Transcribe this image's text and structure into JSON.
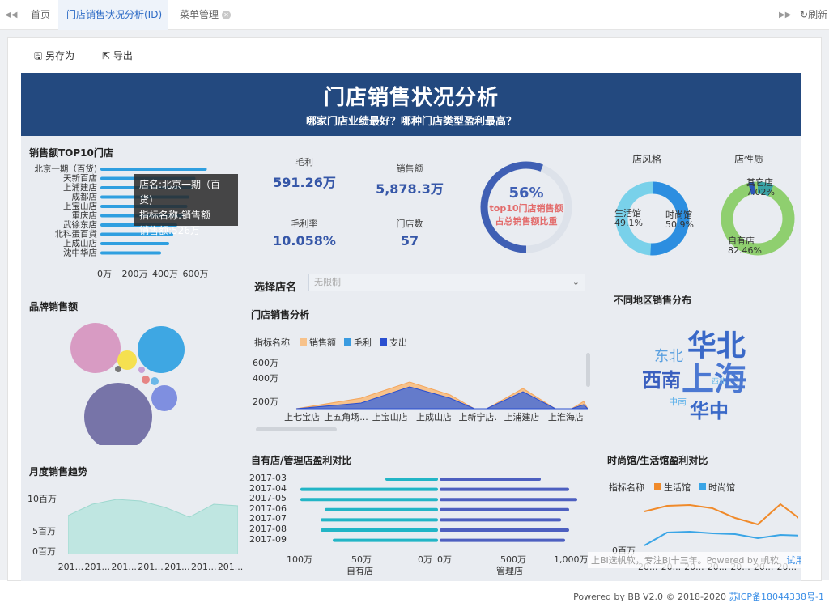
{
  "tabs": {
    "home": "首页",
    "active": "门店销售状况分析(ID)",
    "menu": "菜单管理",
    "refresh": "刷新"
  },
  "toolbar": {
    "save_as": "另存为",
    "export": "导出"
  },
  "banner": {
    "title": "门店销售状况分析",
    "subtitle": "哪家门店业绩最好？哪种门店类型盈利最高？"
  },
  "top10": {
    "title": "销售额TOP10门店",
    "stores": [
      "北京一期（百货)",
      "天新百店",
      "上浦建店",
      "成都店",
      "上宝山店",
      "重庆店",
      "武徐东店",
      "北科蛋百貨",
      "上成山店",
      "沈中华店"
    ],
    "values": [
      526,
      470,
      455,
      440,
      430,
      410,
      380,
      360,
      340,
      300
    ],
    "ticks": [
      "0万",
      "200万",
      "400万",
      "600万"
    ],
    "tooltip": {
      "line1": "店名:北京一期（百货)",
      "line2": "指标名称:销售额",
      "line3": "销售额:526万"
    }
  },
  "kpi": {
    "gross_label": "毛利",
    "gross": "591.26万",
    "sales_label": "销售额",
    "sales": "5,878.3万",
    "rate_label": "毛利率",
    "rate": "10.058%",
    "count_label": "门店数",
    "count": "57"
  },
  "gauge": {
    "value": "56%",
    "caption1": "top10门店销售额",
    "caption2": "占总销售额比重",
    "fraction": 0.56
  },
  "style_pie": {
    "title": "店风格",
    "l1": "生活馆",
    "v1": "49.1%",
    "l2": "时尚馆",
    "v2": "50.9%"
  },
  "nature_pie": {
    "title": "店性质",
    "l1": "其它店",
    "v1": "7.02%",
    "l2": "自有店",
    "v2": "82.46%"
  },
  "brand": {
    "title": "品牌销售额"
  },
  "select": {
    "label": "选择店名",
    "placeholder": "无限制"
  },
  "store_analysis": {
    "title": "门店销售分析",
    "legend_label": "指标名称",
    "legend": [
      "销售额",
      "毛利",
      "支出"
    ],
    "yticks": [
      "600万",
      "400万",
      "200万"
    ],
    "xticks": [
      "上七宝店",
      "上五角场...",
      "上宝山店",
      "上成山店",
      "上新宁店.",
      "上浦建店",
      "上淮海店"
    ]
  },
  "region": {
    "title": "不同地区销售分布",
    "words": [
      "华北",
      "上海",
      "西南",
      "东北",
      "华中",
      "中南",
      "西北"
    ]
  },
  "monthly": {
    "title": "月度销售趋势",
    "yticks": [
      "10百万",
      "5百万",
      "0百万"
    ],
    "xticks": [
      "201...",
      "201...",
      "201...",
      "201...",
      "201...",
      "201...",
      "201..."
    ]
  },
  "own_vs_mgmt": {
    "title": "自有店/管理店盈利对比",
    "months": [
      "2017-03",
      "2017-04",
      "2017-05",
      "2017-06",
      "2017-07",
      "2017-08",
      "2017-09"
    ],
    "left_ticks": [
      "100万",
      "50万",
      "0万"
    ],
    "right_ticks": [
      "0万",
      "500万",
      "1,000万"
    ],
    "left_label": "自有店",
    "right_label": "管理店"
  },
  "fashion_life": {
    "title": "时尚馆/生活馆盈利对比",
    "legend_label": "指标名称",
    "legend": [
      "生活馆",
      "时尚馆"
    ],
    "ytick": "0百万",
    "xticks": [
      "20...",
      "20...",
      "20...",
      "20...",
      "20...",
      "20...",
      "20..."
    ]
  },
  "watermark": {
    "text": "上BI选帆软，专注BI十三年。Powered by 帆软",
    "link": "试用模式"
  },
  "footer": {
    "text": "Powered by BB V2.0 © 2018-2020",
    "icp": "苏ICP备18044338号-1"
  },
  "colors": {
    "banner": "#23497f",
    "accent": "#3a8ee6",
    "orange": "#f7c28b",
    "blue": "#3a69c8"
  }
}
